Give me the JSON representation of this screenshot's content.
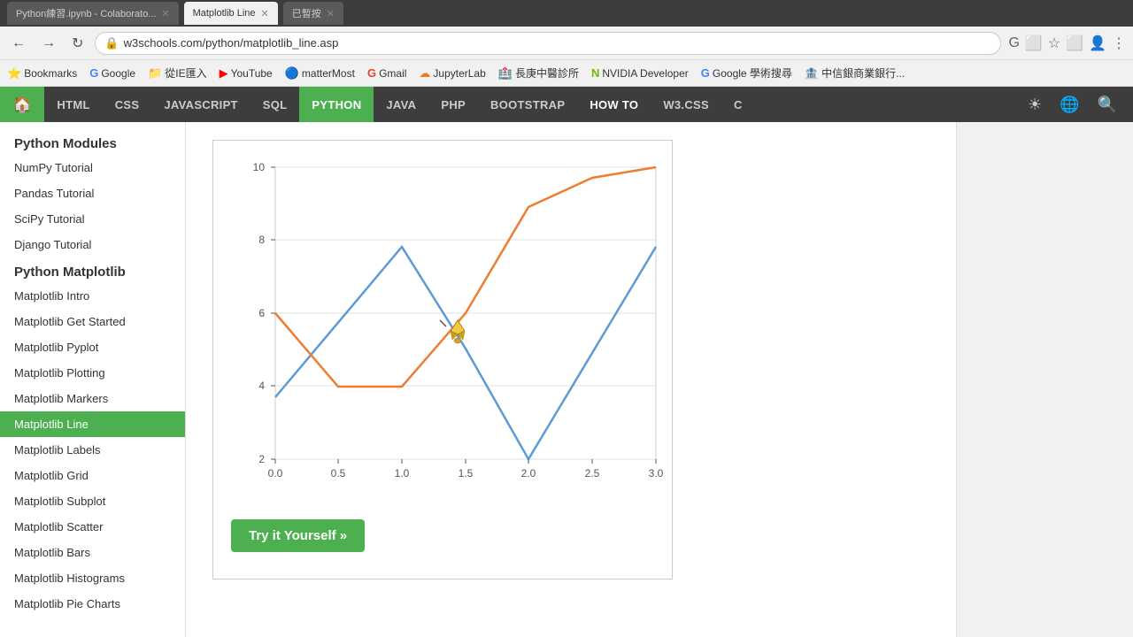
{
  "browser": {
    "tabs": [
      {
        "label": "Python練習.ipynb - Colaborato...",
        "active": false
      },
      {
        "label": "Matplotlib Line",
        "active": true
      },
      {
        "label": "已暫按",
        "active": false
      }
    ],
    "address": "w3schools.com/python/matplotlib_line.asp",
    "bookmarks": [
      {
        "icon": "⭐",
        "label": "Bookmarks"
      },
      {
        "icon": "G",
        "label": "Google"
      },
      {
        "icon": "📁",
        "label": "從IE匯入"
      },
      {
        "icon": "▶",
        "label": "YouTube"
      },
      {
        "icon": "🔵",
        "label": "matterMost"
      },
      {
        "icon": "G",
        "label": "Gmail"
      },
      {
        "icon": "☁",
        "label": "JupyterLab"
      },
      {
        "icon": "🏥",
        "label": "長庚中醫診所"
      },
      {
        "icon": "N",
        "label": "NVIDIA Developer"
      },
      {
        "icon": "G",
        "label": "Google 學術搜尋"
      },
      {
        "icon": "🏦",
        "label": "中信銀商業銀行..."
      }
    ]
  },
  "navbar": {
    "items": [
      {
        "label": "HTML",
        "active": false
      },
      {
        "label": "CSS",
        "active": false
      },
      {
        "label": "JAVASCRIPT",
        "active": false
      },
      {
        "label": "SQL",
        "active": false
      },
      {
        "label": "PYTHON",
        "active": true
      },
      {
        "label": "JAVA",
        "active": false
      },
      {
        "label": "PHP",
        "active": false
      },
      {
        "label": "BOOTSTRAP",
        "active": false
      },
      {
        "label": "HOW TO",
        "active": false
      },
      {
        "label": "W3.CSS",
        "active": false
      },
      {
        "label": "C",
        "active": false
      }
    ]
  },
  "sidebar": {
    "section1": "Python Modules",
    "section1_items": [
      {
        "label": "NumPy Tutorial"
      },
      {
        "label": "Pandas Tutorial"
      },
      {
        "label": "SciPy Tutorial"
      },
      {
        "label": "Django Tutorial"
      }
    ],
    "section2": "Python Matplotlib",
    "section2_items": [
      {
        "label": "Matplotlib Intro"
      },
      {
        "label": "Matplotlib Get Started"
      },
      {
        "label": "Matplotlib Pyplot"
      },
      {
        "label": "Matplotlib Plotting"
      },
      {
        "label": "Matplotlib Markers"
      },
      {
        "label": "Matplotlib Line",
        "active": true
      },
      {
        "label": "Matplotlib Labels"
      },
      {
        "label": "Matplotlib Grid"
      },
      {
        "label": "Matplotlib Subplot"
      },
      {
        "label": "Matplotlib Scatter"
      },
      {
        "label": "Matplotlib Bars"
      },
      {
        "label": "Matplotlib Histograms"
      },
      {
        "label": "Matplotlib Pie Charts"
      }
    ]
  },
  "chart": {
    "x_labels": [
      "0.0",
      "0.5",
      "1.0",
      "1.5",
      "2.0",
      "2.5",
      "3.0"
    ],
    "y_labels": [
      "2",
      "4",
      "6",
      "8",
      "10"
    ]
  },
  "try_button": "Try it Yourself »"
}
